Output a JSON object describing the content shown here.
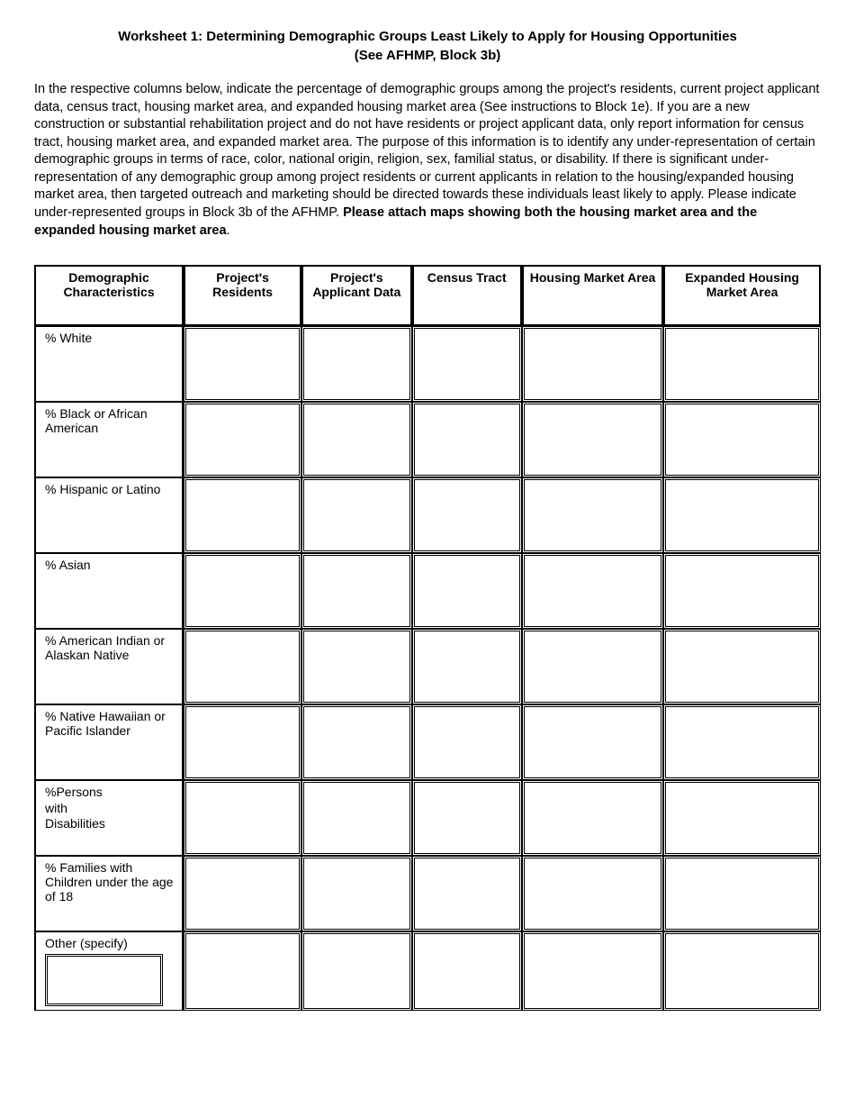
{
  "title_line1": "Worksheet 1: Determining Demographic Groups Least Likely to Apply for Housing Opportunities",
  "title_line2": "(See AFHMP, Block 3b)",
  "intro_plain": "In the respective columns below, indicate the percentage of demographic groups among the project's residents, current project applicant data, census tract, housing market area, and expanded housing market area (See instructions to Block 1e). If you are a new construction or substantial rehabilitation project and do not have residents or project applicant data, only report information for census tract, housing market area, and expanded market area. The purpose of this information is to identify any under-representation of certain demographic groups in terms of race, color, national origin, religion, sex, familial status, or disability. If there is significant under-representation of any demographic group among project residents or current applicants in relation to the housing/expanded housing market area, then targeted outreach and marketing should be directed towards these individuals least likely to apply. Please indicate under-represented groups in Block 3b of the AFHMP. ",
  "intro_bold": "Please attach maps showing both the housing market area and the expanded housing market area",
  "intro_period": ".",
  "headers": {
    "c1": "Demographic Characteristics",
    "c2": "Project's Residents",
    "c3": "Project's Applicant Data",
    "c4": "Census Tract",
    "c5": "Housing Market Area",
    "c6": "Expanded Housing Market Area"
  },
  "rows": [
    {
      "label": "% White"
    },
    {
      "label": "% Black or African American"
    },
    {
      "label": "% Hispanic or Latino"
    },
    {
      "label": "% Asian"
    },
    {
      "label": "% American Indian or Alaskan Native"
    },
    {
      "label": "% Native Hawaiian or Pacific Islander"
    },
    {
      "label": "%Persons with Disabilities",
      "narrow": true
    },
    {
      "label": "% Families with Children under the age of 18"
    },
    {
      "label": "Other (specify)",
      "has_input": true
    }
  ]
}
